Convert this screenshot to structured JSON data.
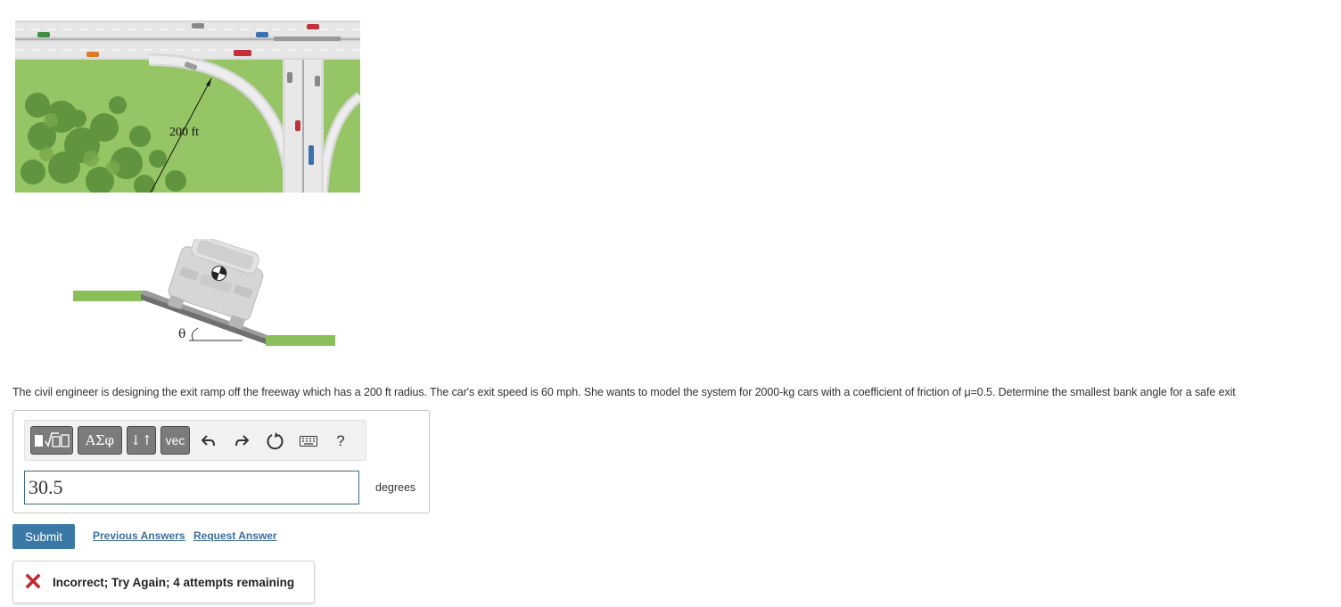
{
  "figures": {
    "map": {
      "radius_label": "200 ft"
    },
    "bank": {
      "angle_label": "θ"
    }
  },
  "problem": {
    "text": "The civil engineer is designing the exit ramp off the freeway which has a 200 ft radius.  The car's exit speed is 60 mph.  She wants to model the system for 2000-kg cars with a coefficient of friction of μ=0.5.  Determine the smallest bank angle for a safe exit"
  },
  "toolbar": {
    "greek_label": "ΑΣφ",
    "arrows_label": "↓↑",
    "vec_label": "vec",
    "help_label": "?"
  },
  "answer": {
    "value": "30.5",
    "unit": "degrees"
  },
  "actions": {
    "submit_label": "Submit",
    "previous_answers_label": "Previous Answers",
    "request_answer_label": "Request Answer"
  },
  "feedback": {
    "message": "Incorrect; Try Again; 4 attempts remaining",
    "icon": "x-icon",
    "color": "#c0272d"
  },
  "colors": {
    "accent": "#3a79a6",
    "link": "#3b6f9b",
    "input_border": "#3b6a86"
  }
}
